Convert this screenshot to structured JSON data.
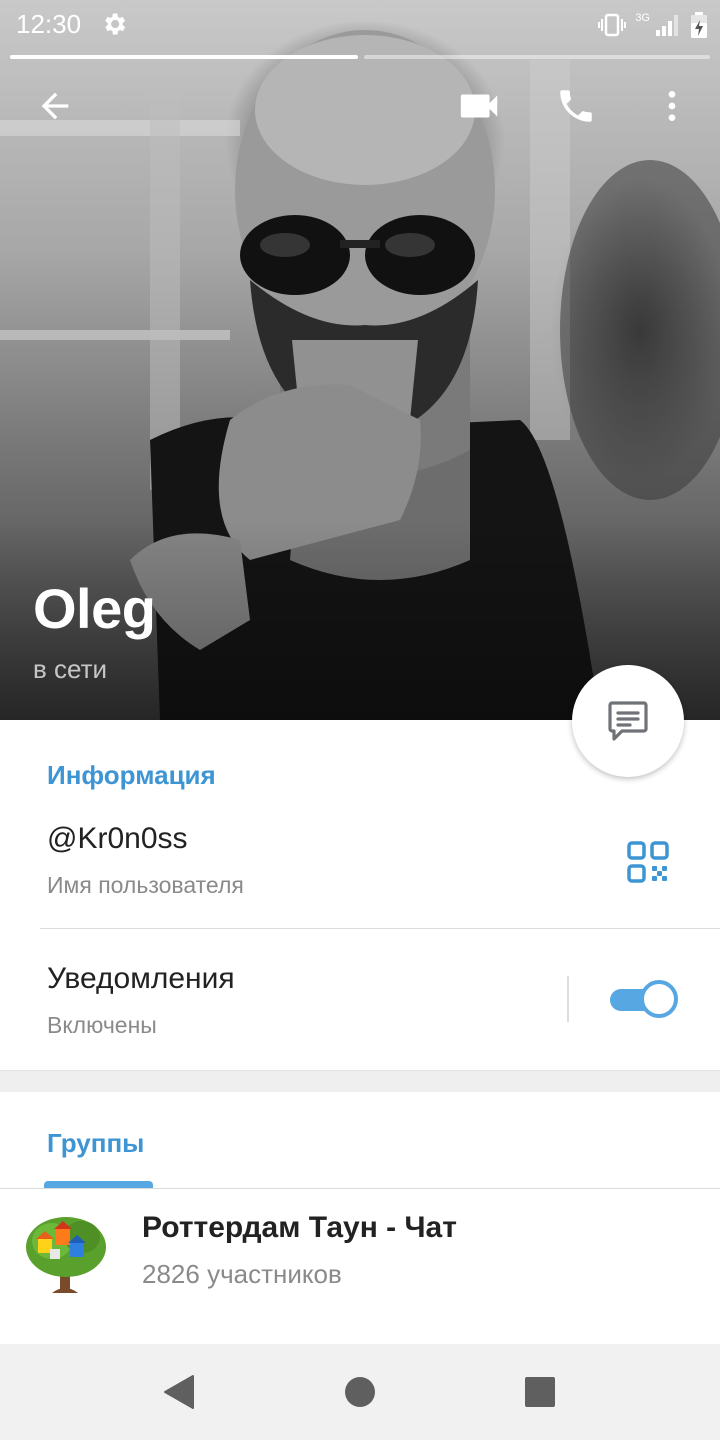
{
  "status_bar": {
    "time": "12:30",
    "network": "3G"
  },
  "profile": {
    "name": "Oleg",
    "status": "в сети"
  },
  "info": {
    "section_title": "Информация",
    "username": "@Kr0n0ss",
    "username_caption": "Имя пользователя",
    "notifications_title": "Уведомления",
    "notifications_state": "Включены",
    "notifications_on": true
  },
  "groups": {
    "tab_label": "Группы",
    "items": [
      {
        "name": "Роттердам Таун - Чат",
        "members": "2826 участников"
      }
    ]
  },
  "colors": {
    "accent": "#3d95d4",
    "toggle": "#56a7e2"
  },
  "icons": {
    "back": "arrow-left",
    "video": "video-camera",
    "call": "phone",
    "menu": "more-vertical",
    "message": "chat-bubble",
    "qr": "qr-code"
  }
}
